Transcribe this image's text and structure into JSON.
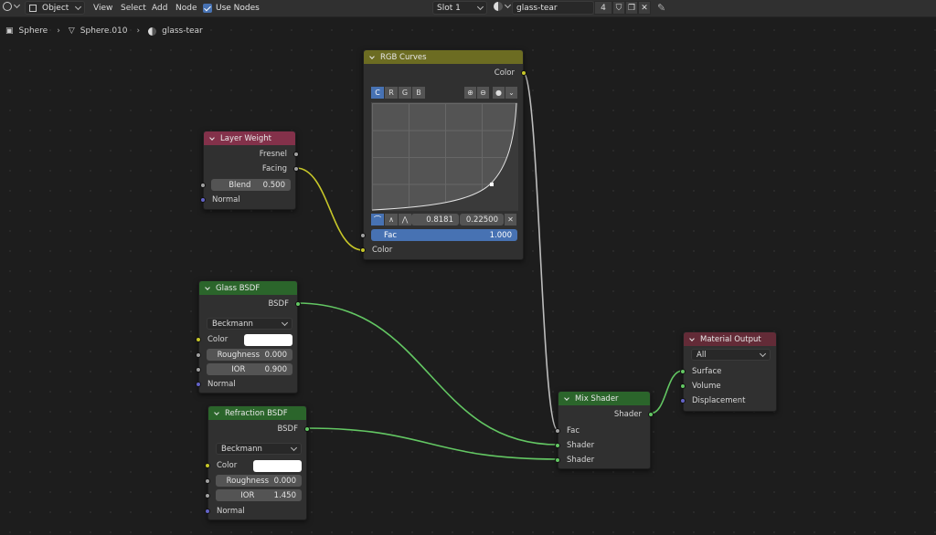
{
  "header": {
    "mode": "Object",
    "menu": [
      "View",
      "Select",
      "Add",
      "Node"
    ],
    "use_nodes_label": "Use Nodes",
    "slot": "Slot 1",
    "material_name": "glass-tear",
    "users_count": "4"
  },
  "breadcrumb": {
    "object": "Sphere",
    "mesh": "Sphere.010",
    "material": "glass-tear"
  },
  "nodes": {
    "layer_weight": {
      "title": "Layer Weight",
      "out_fresnel": "Fresnel",
      "out_facing": "Facing",
      "blend_label": "Blend",
      "blend_value": "0.500",
      "normal_label": "Normal"
    },
    "rgb_curves": {
      "title": "RGB Curves",
      "out_color": "Color",
      "channels": [
        "C",
        "R",
        "G",
        "B"
      ],
      "point_x": "0.8181",
      "point_y": "0.22500",
      "fac_label": "Fac",
      "fac_value": "1.000",
      "in_color": "Color"
    },
    "glass_bsdf": {
      "title": "Glass BSDF",
      "out_bsdf": "BSDF",
      "distribution": "Beckmann",
      "color_label": "Color",
      "roughness_label": "Roughness",
      "roughness_value": "0.000",
      "ior_label": "IOR",
      "ior_value": "0.900",
      "normal_label": "Normal"
    },
    "refraction_bsdf": {
      "title": "Refraction BSDF",
      "out_bsdf": "BSDF",
      "distribution": "Beckmann",
      "color_label": "Color",
      "roughness_label": "Roughness",
      "roughness_value": "0.000",
      "ior_label": "IOR",
      "ior_value": "1.450",
      "normal_label": "Normal"
    },
    "mix_shader": {
      "title": "Mix Shader",
      "out_shader": "Shader",
      "in_fac": "Fac",
      "in_shader1": "Shader",
      "in_shader2": "Shader"
    },
    "material_output": {
      "title": "Material Output",
      "target": "All",
      "in_surface": "Surface",
      "in_volume": "Volume",
      "in_displacement": "Displacement"
    }
  },
  "colors": {
    "input_header": "#83314a",
    "shader_header": "#2b652b",
    "color_header": "#6c6c22",
    "output_header": "#632b37",
    "accent": "#4772b3"
  }
}
